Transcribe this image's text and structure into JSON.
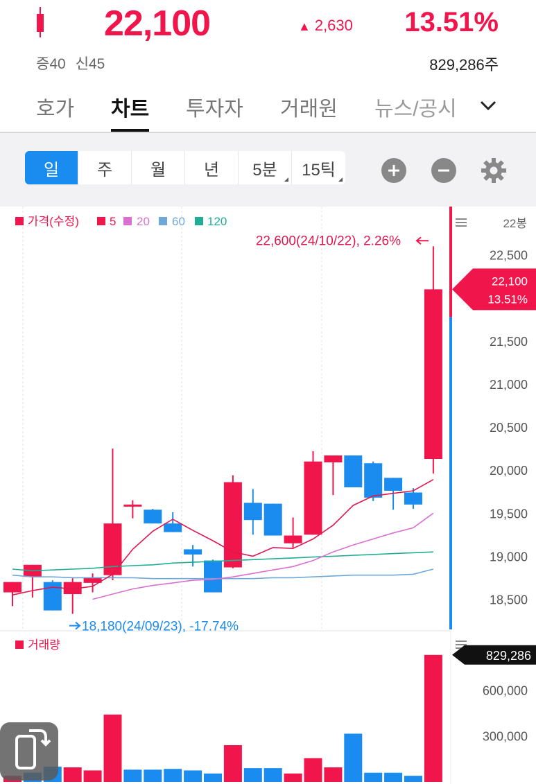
{
  "header": {
    "price": "22,100",
    "change_arrow": "▲",
    "change": "2,630",
    "change_pct": "13.51%",
    "margin_info": [
      "증40",
      "신45"
    ],
    "volume": "829,286주",
    "icon": "candle-icon"
  },
  "tabs": [
    {
      "label": "호가",
      "active": false
    },
    {
      "label": "차트",
      "active": true
    },
    {
      "label": "투자자",
      "active": false
    },
    {
      "label": "거래원",
      "active": false
    },
    {
      "label": "뉴스/공시",
      "active": false
    }
  ],
  "period_buttons": [
    {
      "label": "일",
      "active": true
    },
    {
      "label": "주",
      "active": false
    },
    {
      "label": "월",
      "active": false
    },
    {
      "label": "년",
      "active": false
    },
    {
      "label": "5분",
      "active": false
    },
    {
      "label": "15틱",
      "active": false
    }
  ],
  "icons": {
    "zoom_in": "plus-circle-icon",
    "zoom_out": "minus-circle-icon",
    "settings": "gear-icon",
    "more": "chevron-down-icon",
    "rotate": "screen-rotate-icon"
  },
  "colors": {
    "up": "#f0164c",
    "down": "#1a8cf0",
    "ma5": "#e0174f",
    "ma20": "#d96fd0",
    "ma60": "#6ea8d8",
    "ma120": "#1fae94"
  },
  "chart_data": [
    {
      "type": "candlestick",
      "legend": [
        {
          "label": "가격(수정)",
          "color": "#f0164c"
        },
        {
          "label": "5",
          "color": "#f0164c"
        },
        {
          "label": "20",
          "color": "#d96fd0"
        },
        {
          "label": "60",
          "color": "#6ea8d8"
        },
        {
          "label": "120",
          "color": "#1fae94"
        }
      ],
      "candle_count_label": "22봉",
      "y_ticks": [
        "22,500",
        "21,500",
        "21,000",
        "20,500",
        "20,000",
        "19,500",
        "19,000",
        "18,500"
      ],
      "y_tick_values": [
        22500,
        21500,
        21000,
        20500,
        20000,
        19500,
        19000,
        18500
      ],
      "ylim": [
        18230,
        22900
      ],
      "high_annotation": "22,600(24/10/22), 2.26%",
      "low_annotation": "18,180(24/09/23), -17.74%",
      "current_price_label": "22,100",
      "current_pct_label": "13.51%",
      "candles": [
        {
          "o": 18580,
          "h": 18700,
          "l": 18420,
          "c": 18700
        },
        {
          "o": 18760,
          "h": 18780,
          "l": 18520,
          "c": 18900
        },
        {
          "o": 18700,
          "h": 18720,
          "l": 18370,
          "c": 18370
        },
        {
          "o": 18560,
          "h": 18750,
          "l": 18330,
          "c": 18700
        },
        {
          "o": 18690,
          "h": 18800,
          "l": 18580,
          "c": 18750
        },
        {
          "o": 18780,
          "h": 20250,
          "l": 18720,
          "c": 19380
        },
        {
          "o": 19600,
          "h": 19650,
          "l": 19440,
          "c": 19600
        },
        {
          "o": 19540,
          "h": 19550,
          "l": 19380,
          "c": 19380
        },
        {
          "o": 19380,
          "h": 19510,
          "l": 19280,
          "c": 19280
        },
        {
          "o": 19080,
          "h": 19130,
          "l": 18880,
          "c": 19020
        },
        {
          "o": 18950,
          "h": 18960,
          "l": 18580,
          "c": 18580
        },
        {
          "o": 18870,
          "h": 19940,
          "l": 18860,
          "c": 19860
        },
        {
          "o": 19620,
          "h": 19780,
          "l": 19250,
          "c": 19420
        },
        {
          "o": 19610,
          "h": 19610,
          "l": 19240,
          "c": 19240
        },
        {
          "o": 19150,
          "h": 19450,
          "l": 19100,
          "c": 19240
        },
        {
          "o": 19250,
          "h": 20220,
          "l": 19250,
          "c": 20100
        },
        {
          "o": 20090,
          "h": 20170,
          "l": 19710,
          "c": 20170
        },
        {
          "o": 20170,
          "h": 20170,
          "l": 19800,
          "c": 19800
        },
        {
          "o": 20080,
          "h": 20100,
          "l": 19640,
          "c": 19680
        },
        {
          "o": 19910,
          "h": 19910,
          "l": 19540,
          "c": 19760
        },
        {
          "o": 19740,
          "h": 19790,
          "l": 19550,
          "c": 19600
        },
        {
          "o": 20130,
          "h": 22600,
          "l": 19960,
          "c": 22100
        }
      ],
      "ma5": [
        18550,
        18600,
        18640,
        18620,
        18650,
        18790,
        19080,
        19290,
        19430,
        19300,
        19180,
        19050,
        19000,
        19100,
        19090,
        19200,
        19360,
        19590,
        19700,
        19730,
        19760,
        19890
      ],
      "ma20": [
        null,
        null,
        null,
        null,
        18500,
        18560,
        18620,
        18660,
        18690,
        18720,
        18730,
        18760,
        18800,
        18840,
        18880,
        18950,
        19050,
        19130,
        19200,
        19270,
        19330,
        19500
      ],
      "ma60": [
        18780,
        18760,
        18760,
        18750,
        18750,
        18750,
        18750,
        18740,
        18740,
        18740,
        18740,
        18740,
        18740,
        18750,
        18750,
        18760,
        18770,
        18780,
        18780,
        18780,
        18790,
        18850
      ],
      "ma120": [
        18850,
        18830,
        18840,
        18850,
        18860,
        18880,
        18890,
        18900,
        18920,
        18930,
        18940,
        18950,
        18960,
        18970,
        18980,
        18990,
        19000,
        19010,
        19020,
        19030,
        19040,
        19050
      ]
    },
    {
      "type": "bar",
      "title": "거래량",
      "y_ticks": [
        "600,000",
        "300,000"
      ],
      "y_tick_values": [
        600000,
        300000
      ],
      "current_label": "829,286",
      "values": [
        40000,
        60000,
        100000,
        95000,
        75000,
        440000,
        80000,
        80000,
        85000,
        75000,
        55000,
        240000,
        90000,
        90000,
        55000,
        155000,
        95000,
        315000,
        60000,
        60000,
        40000,
        829286
      ],
      "up": [
        true,
        false,
        false,
        true,
        true,
        true,
        false,
        false,
        false,
        false,
        false,
        true,
        false,
        false,
        true,
        true,
        true,
        false,
        false,
        false,
        false,
        true
      ]
    }
  ]
}
